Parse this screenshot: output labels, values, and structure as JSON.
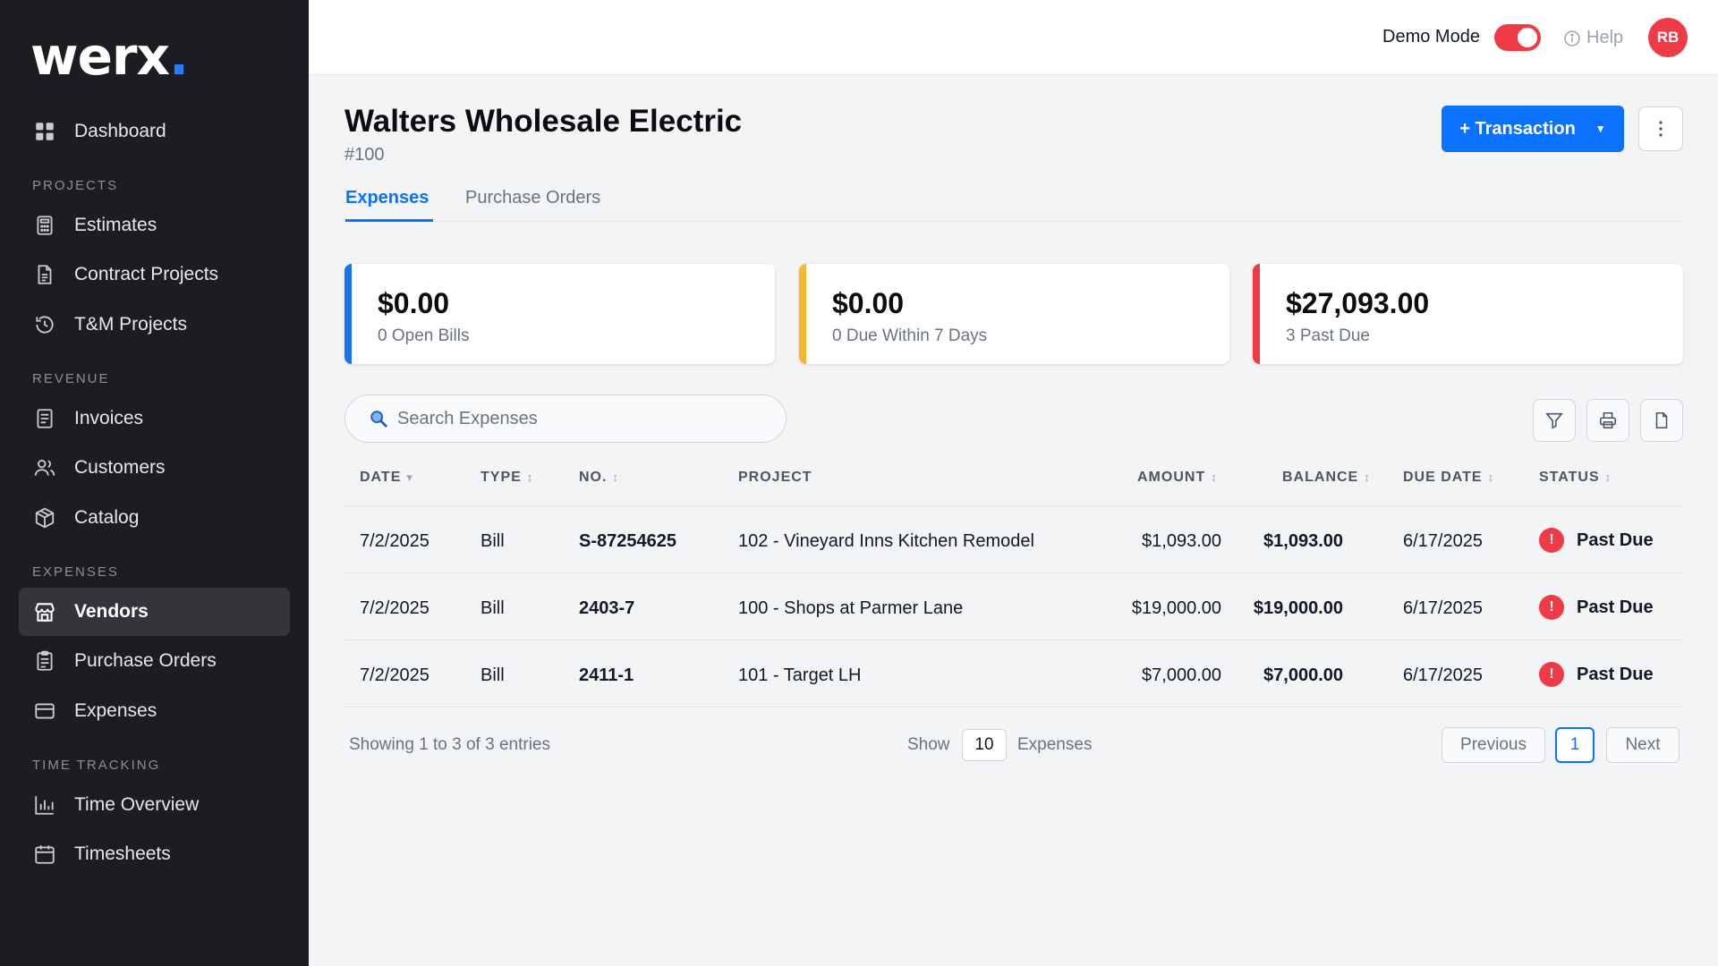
{
  "app": {
    "logo": "werx",
    "logo_dot": "."
  },
  "sidebar": {
    "dashboard": "Dashboard",
    "sections": {
      "projects": "PROJECTS",
      "revenue": "REVENUE",
      "expenses": "EXPENSES",
      "time": "TIME TRACKING"
    },
    "items": {
      "estimates": "Estimates",
      "contract_projects": "Contract Projects",
      "tm_projects": "T&M Projects",
      "invoices": "Invoices",
      "customers": "Customers",
      "catalog": "Catalog",
      "vendors": "Vendors",
      "purchase_orders": "Purchase Orders",
      "expenses": "Expenses",
      "time_overview": "Time Overview",
      "timesheets": "Timesheets"
    },
    "active": "vendors"
  },
  "topbar": {
    "demo_mode": "Demo Mode",
    "help": "Help",
    "avatar_initials": "RB",
    "demo_on": true
  },
  "page": {
    "title": "Walters Wholesale Electric",
    "subtitle": "#100",
    "transaction_button": "+ Transaction",
    "more_icon": "vertical-ellipsis-icon"
  },
  "tabs": {
    "expenses": "Expenses",
    "purchase_orders": "Purchase Orders",
    "active": "expenses"
  },
  "cards": [
    {
      "amount": "$0.00",
      "label": "0 Open Bills",
      "color": "#1a73e8"
    },
    {
      "amount": "$0.00",
      "label": "0 Due Within 7 Days",
      "color": "#f5b731"
    },
    {
      "amount": "$27,093.00",
      "label": "3 Past Due",
      "color": "#ef3b47"
    }
  ],
  "search": {
    "placeholder": "Search Expenses",
    "value": ""
  },
  "table": {
    "headers": {
      "date": "DATE",
      "type": "TYPE",
      "no": "NO.",
      "project": "PROJECT",
      "amount": "AMOUNT",
      "balance": "BALANCE",
      "due_date": "DUE DATE",
      "status": "STATUS"
    },
    "sort_icons": {
      "desc": "▾",
      "both": "↕"
    },
    "rows": [
      {
        "date": "7/2/2025",
        "type": "Bill",
        "no": "S-87254625",
        "project": "102 - Vineyard Inns Kitchen Remodel",
        "amount": "$1,093.00",
        "balance": "$1,093.00",
        "due_date": "6/17/2025",
        "status": "Past Due"
      },
      {
        "date": "7/2/2025",
        "type": "Bill",
        "no": "2403-7",
        "project": "100 - Shops at Parmer Lane",
        "amount": "$19,000.00",
        "balance": "$19,000.00",
        "due_date": "6/17/2025",
        "status": "Past Due"
      },
      {
        "date": "7/2/2025",
        "type": "Bill",
        "no": "2411-1",
        "project": "101 - Target LH",
        "amount": "$7,000.00",
        "balance": "$7,000.00",
        "due_date": "6/17/2025",
        "status": "Past Due"
      }
    ],
    "status_icon": "!"
  },
  "footer": {
    "showing": "Showing 1 to 3 of 3 entries",
    "show_label": "Show",
    "page_size": "10",
    "unit": "Expenses",
    "previous": "Previous",
    "current_page": "1",
    "next": "Next"
  }
}
